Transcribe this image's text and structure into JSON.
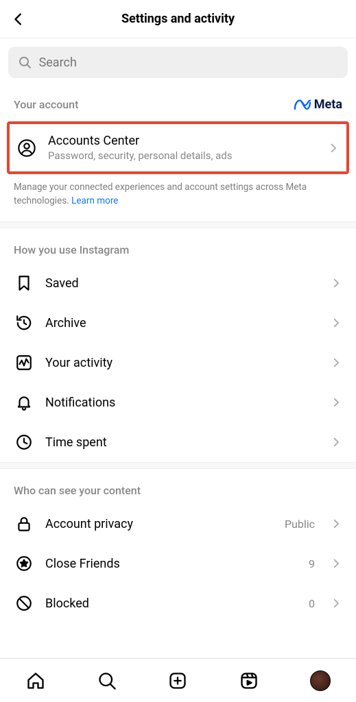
{
  "header": {
    "title": "Settings and activity"
  },
  "search": {
    "placeholder": "Search"
  },
  "account_section": {
    "label": "Your account",
    "brand": "Meta",
    "item": {
      "title": "Accounts Center",
      "subtitle": "Password, security, personal details, ads"
    },
    "info": "Manage your connected experiences and account settings across Meta technologies. ",
    "learn_more": "Learn more"
  },
  "usage_section": {
    "label": "How you use Instagram",
    "items": [
      {
        "label": "Saved"
      },
      {
        "label": "Archive"
      },
      {
        "label": "Your activity"
      },
      {
        "label": "Notifications"
      },
      {
        "label": "Time spent"
      }
    ]
  },
  "privacy_section": {
    "label": "Who can see your content",
    "items": [
      {
        "label": "Account privacy",
        "value": "Public"
      },
      {
        "label": "Close Friends",
        "value": "9"
      },
      {
        "label": "Blocked",
        "value": "0"
      }
    ]
  }
}
